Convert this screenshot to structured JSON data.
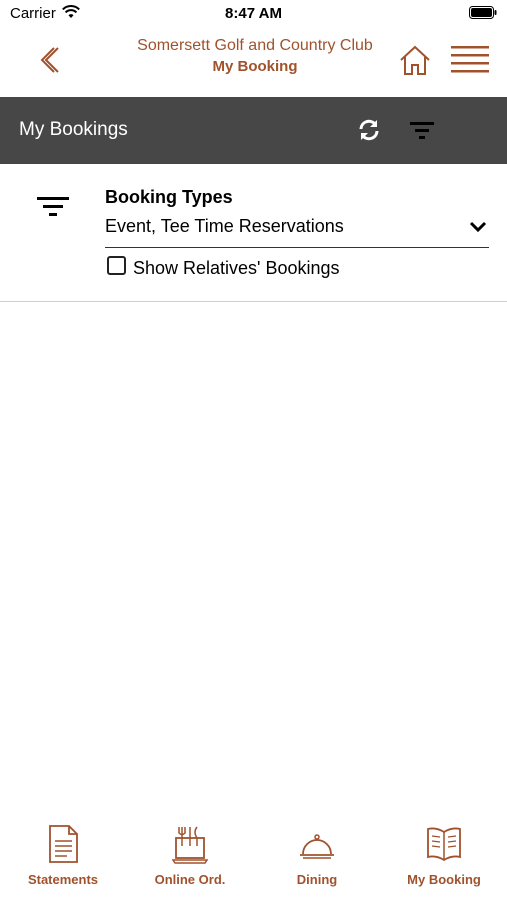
{
  "status_bar": {
    "carrier": "Carrier",
    "time": "8:47 AM"
  },
  "header": {
    "club_name": "Somersett Golf and Country Club",
    "subtitle": "My Booking",
    "accent_color": "#a0522d"
  },
  "toolbar": {
    "title": "My Bookings",
    "background": "#474747"
  },
  "filter": {
    "booking_types_label": "Booking Types",
    "booking_types_value": "Event, Tee Time Reservations",
    "show_relatives_label": "Show Relatives' Bookings",
    "show_relatives_checked": false
  },
  "tab_bar": {
    "tabs": [
      {
        "label": "Statements",
        "icon": "statement-document-icon"
      },
      {
        "label": "Online Ord.",
        "icon": "online-order-icon"
      },
      {
        "label": "Dining",
        "icon": "dining-cloche-icon"
      },
      {
        "label": "My Booking",
        "icon": "booking-book-icon"
      }
    ]
  }
}
